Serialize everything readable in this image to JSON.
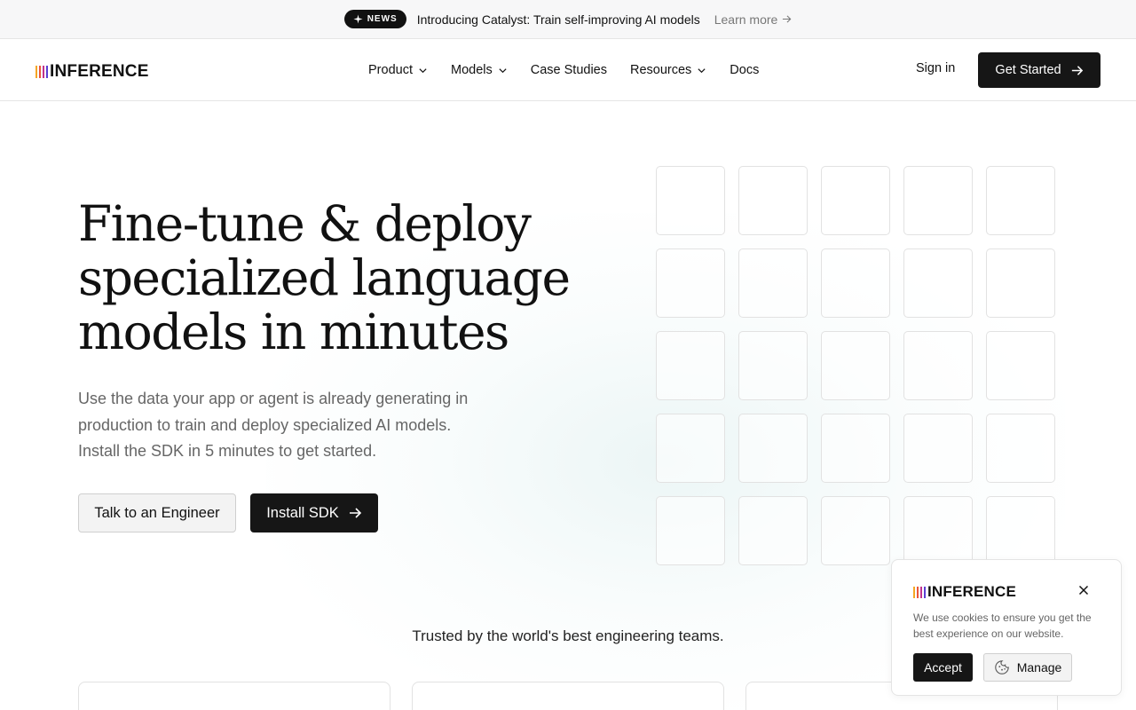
{
  "announcement": {
    "badge": "NEWS",
    "text": "Introducing Catalyst: Train self-improving AI models",
    "link": "Learn more"
  },
  "brand": {
    "name": "INFERENCE",
    "bar_colors": [
      "#f5a623",
      "#e8563a",
      "#c0338d",
      "#5b3fd3"
    ]
  },
  "nav": {
    "items": [
      {
        "label": "Product",
        "has_dropdown": true
      },
      {
        "label": "Models",
        "has_dropdown": true
      },
      {
        "label": "Case Studies",
        "has_dropdown": false
      },
      {
        "label": "Resources",
        "has_dropdown": true
      },
      {
        "label": "Docs",
        "has_dropdown": false
      }
    ],
    "signin": "Sign in",
    "get_started": "Get Started"
  },
  "hero": {
    "headline_lines": [
      "Fine-tune & deploy",
      "specialized language",
      "models in minutes"
    ],
    "subtext": "Use the data your app or agent is already generating in production to train and deploy specialized AI models. Install the SDK in 5 minutes to get started.",
    "talk_button": "Talk to an Engineer",
    "install_button": "Install SDK"
  },
  "trusted": {
    "heading": "Trusted by the world's best engineering teams."
  },
  "cookie": {
    "brand": "INFERENCE",
    "text": "We use cookies to ensure you get the best experience on our website.",
    "accept": "Accept",
    "manage": "Manage"
  },
  "colors": {
    "primary_button": "#161616",
    "border": "#e2e2e2",
    "muted_text": "#666666"
  }
}
